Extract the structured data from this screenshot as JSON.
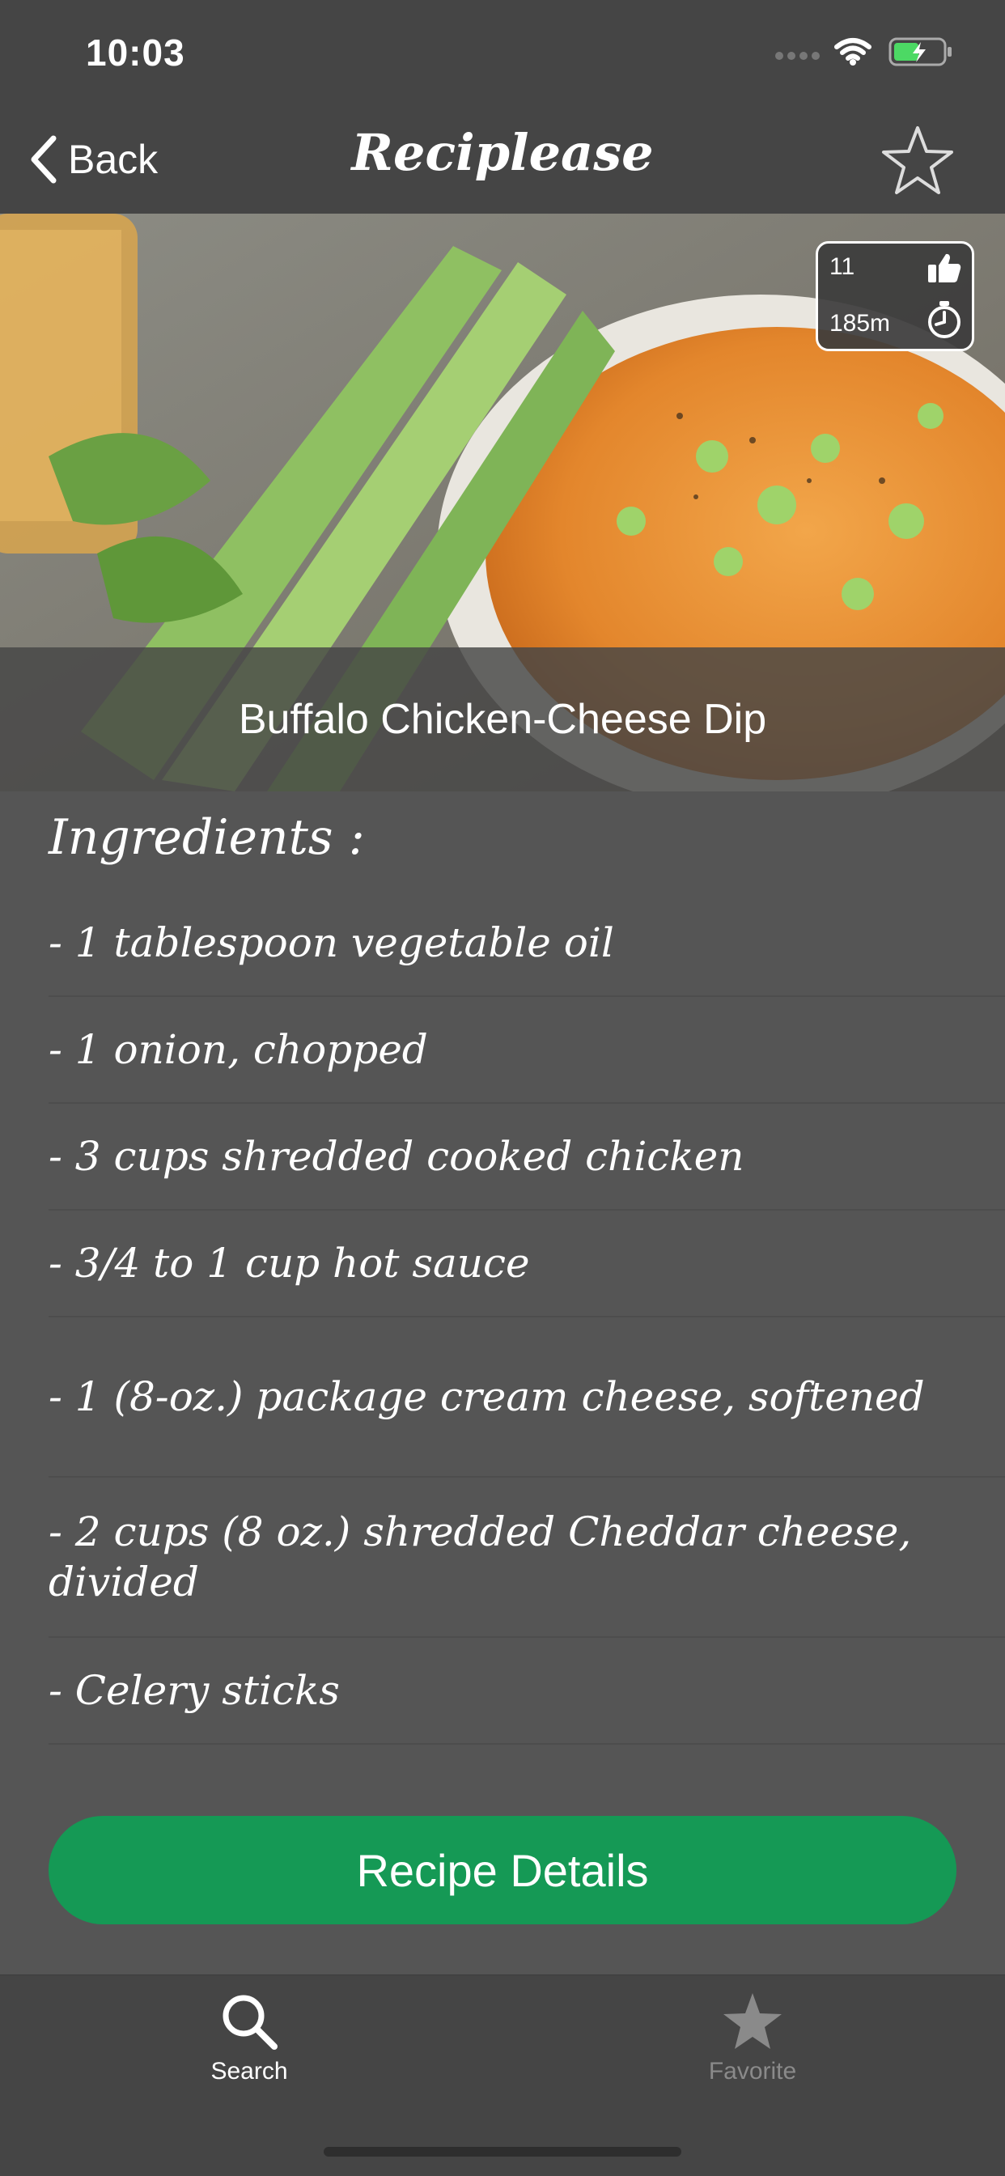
{
  "status_bar": {
    "time": "10:03",
    "icons": [
      "cellular-signal-icon",
      "wifi-icon",
      "battery-charging-icon"
    ]
  },
  "nav": {
    "back_label": "Back",
    "title": "Reciplease",
    "favorite_icon": "star-outline-icon"
  },
  "recipe": {
    "name": "Buffalo Chicken-Cheese Dip",
    "likes": "11",
    "duration": "185m",
    "icons": [
      "thumbs-up-icon",
      "timer-icon"
    ]
  },
  "ingredients": {
    "heading": "Ingredients :",
    "items": [
      "- 1 tablespoon  vegetable oil",
      "- 1   onion, chopped",
      "- 3 cups  shredded cooked chicken",
      "- 3/4   to 1 cup hot sauce",
      "- 1   (8-oz.) package cream cheese, softened",
      "- 2 cups  (8 oz.) shredded Cheddar cheese, divided",
      "- Celery sticks"
    ]
  },
  "actions": {
    "details_label": "Recipe Details"
  },
  "tabs": [
    {
      "label": "Search",
      "icon": "magnifier-icon",
      "selected": true
    },
    {
      "label": "Favorite",
      "icon": "star-filled-icon",
      "selected": false
    }
  ],
  "colors": {
    "background": "#555555",
    "bars": "#454545",
    "accent_green": "#159955",
    "battery_green": "#4cd964"
  }
}
